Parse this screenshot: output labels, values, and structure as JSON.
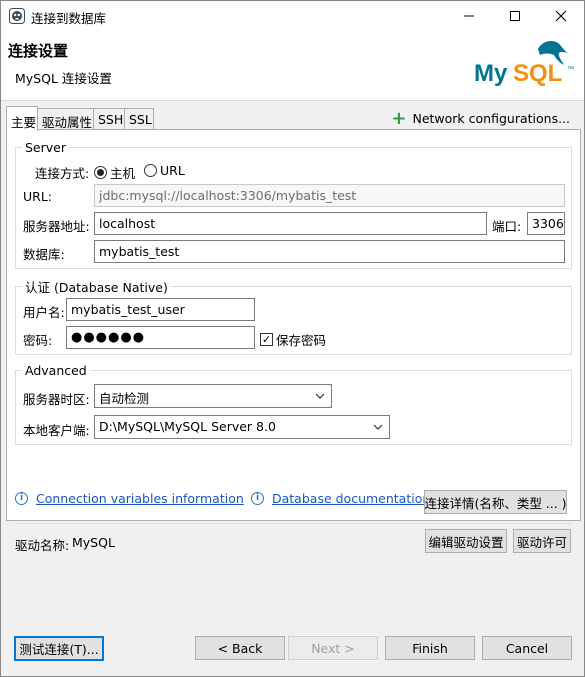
{
  "window": {
    "title": "连接到数据库",
    "controls": {
      "minimize": "minimize",
      "maximize": "maximize",
      "close": "close"
    }
  },
  "header": {
    "title": "连接设置",
    "subtitle": "MySQL 连接设置",
    "logo_text_1": "My",
    "logo_text_2": "SQL",
    "logo_tm": "™"
  },
  "tabs": [
    {
      "label": "主要",
      "active": true
    },
    {
      "label": "驱动属性",
      "active": false
    },
    {
      "label": "SSH",
      "active": false
    },
    {
      "label": "SSL",
      "active": false
    }
  ],
  "network_config": {
    "label": "Network configurations..."
  },
  "server": {
    "legend": "Server",
    "connect_mode_label": "连接方式:",
    "mode_host": "主机",
    "mode_url": "URL",
    "selected_mode": "主机",
    "url_label": "URL:",
    "url_value": "jdbc:mysql://localhost:3306/mybatis_test",
    "host_label": "服务器地址:",
    "host_value": "localhost",
    "port_label": "端口:",
    "port_value": "3306",
    "database_label": "数据库:",
    "database_value": "mybatis_test"
  },
  "auth": {
    "legend": "认证 (Database Native)",
    "user_label": "用户名:",
    "user_value": "mybatis_test_user",
    "password_label": "密码:",
    "password_value": "●●●●●●",
    "save_password_label": "保存密码",
    "save_password_checked": true
  },
  "advanced": {
    "legend": "Advanced",
    "timezone_label": "服务器时区:",
    "timezone_value": "自动检测",
    "client_label": "本地客户端:",
    "client_value": "D:\\MySQL\\MySQL Server 8.0"
  },
  "links": {
    "conn_vars": "Connection variables information",
    "db_docs": "Database documentation",
    "conn_details_button": "连接详情(名称、类型 ... )"
  },
  "driver": {
    "name_label": "驱动名称:",
    "name_value": "MySQL",
    "edit_button": "编辑驱动设置",
    "license_button": "驱动许可"
  },
  "footer": {
    "test_button": "测试连接(T)...",
    "back_button": "< Back",
    "next_button": "Next >",
    "finish_button": "Finish",
    "cancel_button": "Cancel"
  },
  "colors": {
    "link": "#1a55c8",
    "plus": "#2e9b3e",
    "mysql_blue": "#00758f",
    "mysql_orange": "#f29111",
    "focus": "#0078d7"
  }
}
